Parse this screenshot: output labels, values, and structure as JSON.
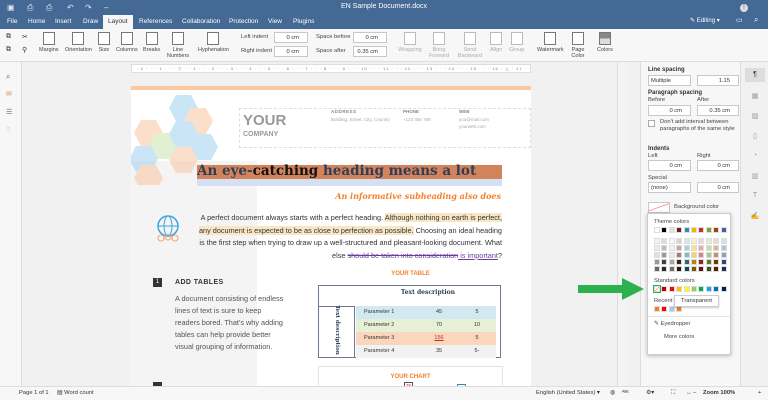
{
  "app": {
    "title": "EN Sample Document.docx",
    "editing": "Editing"
  },
  "tabs": [
    "File",
    "Home",
    "Insert",
    "Draw",
    "Layout",
    "References",
    "Collaboration",
    "Protection",
    "View",
    "Plugins"
  ],
  "toolbar": {
    "buttons": [
      "Margins",
      "Orientation",
      "Size",
      "Columns",
      "Breaks",
      "Line Numbers",
      "Hyphenation"
    ],
    "arrange": [
      "Wrapping",
      "Bring Forward",
      "Send Backward",
      "Align",
      "Group"
    ],
    "page": [
      "Watermark",
      "Page Color",
      "Colors"
    ],
    "left_indent_label": "Left indent",
    "left_indent": "0 cm",
    "right_indent_label": "Right indent",
    "right_indent": "0 cm",
    "space_before_label": "Space before",
    "space_before": "0 cm",
    "space_after_label": "Space after",
    "space_after": "0.35 cm"
  },
  "ruler": "· · 2 · · · 1 · · · ▽ · · 1 · · · 2 · · · 3 · · · 4 · · · 5 · · · 6 · · · 7 · · · 8 · · · 9 · · · 10 · · · 11 · · · 12 · · · 13 · · · 14 · · · 15 · · · 16 · △ · 17 · ·",
  "doc": {
    "company1": "YOUR",
    "company2": "COMPANY",
    "address_h": "ADDRESS",
    "address": "Building, Street, City, Country",
    "phone_h": "PHONE",
    "phone": "+123 456 789",
    "web_h": "WEB",
    "web1": "you@mail.com",
    "web2": "yourweb.com",
    "heading_a": "An eye-",
    "heading_b": "catching",
    "heading_c": " heading means a lot",
    "subheading": "An informative subheading also does",
    "p1": "A perfect document always starts with a perfect heading. ",
    "p1_hl": "Although nothing on earth is perfect, any document is expected to be as close to perfection as possible.",
    "p1_b": " Choosing an ideal heading is the first step when trying to draw up a well-structured and pleasant-looking document. What else ",
    "p1_strike": "should be taken into consideration",
    "p1_under": " is important",
    "p1_end": "?",
    "sec_num": "1",
    "sec_title": "ADD TABLES",
    "sec_text": "A document consisting of endless lines of text is sure to keep readers bored. That's why adding tables can help provide better visual grouping of information.",
    "table_title": "YOUR TABLE",
    "table_head": "Text description",
    "table_side": "Text description",
    "rows": [
      [
        "Parameter 1",
        "45",
        "5"
      ],
      [
        "Parameter 2",
        "70",
        "10"
      ],
      [
        "Parameter 3",
        "156",
        "5"
      ],
      [
        "Parameter 4",
        "35",
        "5-"
      ]
    ],
    "chart_title": "YOUR CHART",
    "chart_labels": [
      "35",
      "16"
    ]
  },
  "panel": {
    "line_spacing": "Line spacing",
    "ls_type": "Multiple",
    "ls_val": "1.15",
    "para_spacing": "Paragraph spacing",
    "before": "Before",
    "after": "After",
    "before_val": "0 cm",
    "after_val": "0.35 cm",
    "no_interval": "Don't add interval between paragraphs of the same style",
    "indents": "Indents",
    "left": "Left",
    "right": "Right",
    "left_val": "0 cm",
    "right_val": "0 cm",
    "special": "Special",
    "special_val": "(none)",
    "special_num": "0 cm",
    "bg_color": "Background color"
  },
  "palette": {
    "theme": "Theme colors",
    "standard": "Standard colors",
    "recent": "Recent colors",
    "tooltip": "Transparent",
    "eyedropper": "Eyedropper",
    "more": "More colors",
    "theme_top": [
      "#ffffff",
      "#000000",
      "#e7e0cc",
      "#5a2a1e",
      "#2e8fa8",
      "#f4b400",
      "#c0302e",
      "#7aa23a",
      "#9c4a07",
      "#4462a0"
    ],
    "standard_colors": [
      "#c00000",
      "#ff0000",
      "#ffc000",
      "#ffff00",
      "#92d050",
      "#00b050",
      "#00b0f0",
      "#0070c0",
      "#002060"
    ],
    "recent_colors": [
      "#f4812a",
      "#ff0000",
      "#a9c6e0",
      "#f4812a"
    ]
  },
  "status": {
    "page": "Page 1 of 1",
    "word_count": "Word count",
    "language": "English (United States)",
    "zoom": "Zoom 100%"
  },
  "colors": {
    "accent": "#446995",
    "highlight_arrow": "#2bb24c"
  }
}
